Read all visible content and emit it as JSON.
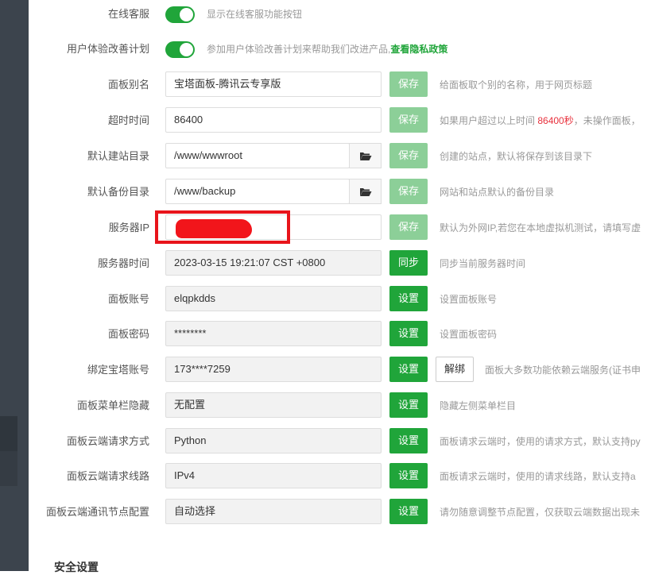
{
  "rows": {
    "online_service": {
      "label": "在线客服",
      "desc": "显示在线客服功能按钮"
    },
    "ux_plan": {
      "label": "用户体验改善计划",
      "desc": "参加用户体验改善计划来帮助我们改进产品,",
      "link": "查看隐私政策"
    },
    "panel_alias": {
      "label": "面板别名",
      "value": "宝塔面板-腾讯云专享版",
      "button": "保存",
      "desc": "给面板取个别的名称，用于网页标题"
    },
    "timeout": {
      "label": "超时时间",
      "value": "86400",
      "button": "保存",
      "desc_pre": "如果用户超过以上时间 ",
      "desc_red": "86400秒",
      "desc_post": "，未操作面板，"
    },
    "default_site_dir": {
      "label": "默认建站目录",
      "value": "/www/wwwroot",
      "button": "保存",
      "desc": "创建的站点，默认将保存到该目录下"
    },
    "default_backup_dir": {
      "label": "默认备份目录",
      "value": "/www/backup",
      "button": "保存",
      "desc": "网站和站点默认的备份目录"
    },
    "server_ip": {
      "label": "服务器IP",
      "button": "保存",
      "desc": "默认为外网IP,若您在本地虚拟机测试，请填写虚"
    },
    "server_time": {
      "label": "服务器时间",
      "value": "2023-03-15 19:21:07 CST +0800",
      "button": "同步",
      "desc": "同步当前服务器时间"
    },
    "panel_account": {
      "label": "面板账号",
      "value": "elqpkdds",
      "button": "设置",
      "desc": "设置面板账号"
    },
    "panel_password": {
      "label": "面板密码",
      "value": "********",
      "button": "设置",
      "desc": "设置面板密码"
    },
    "bt_account": {
      "label": "绑定宝塔账号",
      "value": "173****7259",
      "button": "设置",
      "button2": "解绑",
      "desc": "面板大多数功能依赖云端服务(证书申"
    },
    "menu_hide": {
      "label": "面板菜单栏隐藏",
      "value": "无配置",
      "button": "设置",
      "desc": "隐藏左侧菜单栏目"
    },
    "cloud_request_mode": {
      "label": "面板云端请求方式",
      "value": "Python",
      "button": "设置",
      "desc": "面板请求云端时，使用的请求方式，默认支持py"
    },
    "cloud_request_line": {
      "label": "面板云端请求线路",
      "value": "IPv4",
      "button": "设置",
      "desc": "面板请求云端时，使用的请求线路，默认支持a"
    },
    "cloud_node": {
      "label": "面板云端通讯节点配置",
      "value": "自动选择",
      "button": "设置",
      "desc": "请勿随意调整节点配置，仅获取云端数据出现未"
    }
  },
  "section_title": "安全设置",
  "colors": {
    "green": "#20a53a",
    "light_green": "#8ccf98",
    "red": "#e8303c",
    "sidebar": "#3c444d"
  }
}
